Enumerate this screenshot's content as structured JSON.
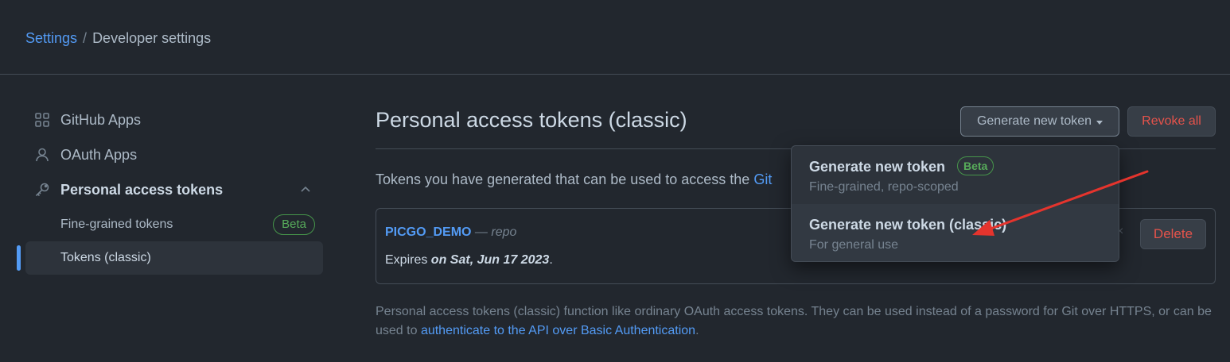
{
  "breadcrumb": {
    "settings_label": "Settings",
    "separator": "/",
    "current_label": "Developer settings"
  },
  "sidebar": {
    "items": [
      {
        "label": "GitHub Apps",
        "icon": "apps-grid-icon"
      },
      {
        "label": "OAuth Apps",
        "icon": "person-icon"
      },
      {
        "label": "Personal access tokens",
        "icon": "key-icon",
        "expanded": true
      }
    ],
    "subitems": [
      {
        "label": "Fine-grained tokens",
        "badge": "Beta"
      },
      {
        "label": "Tokens (classic)",
        "selected": true
      }
    ]
  },
  "main": {
    "title": "Personal access tokens (classic)",
    "generate_button": "Generate new token",
    "revoke_button": "Revoke all",
    "intro_text": "Tokens you have generated that can be used to access the ",
    "intro_link": "Git",
    "token": {
      "name": "PICGO_DEMO",
      "dash": " — ",
      "scope": "repo",
      "expires_prefix": "Expires ",
      "expires_date": "on Sat, Jun 17 2023",
      "expires_suffix": ".",
      "delete_button": "Delete"
    },
    "footnote_text": "Personal access tokens (classic) function like ordinary OAuth access tokens. They can be used instead of a password for Git over HTTPS, or can be used to ",
    "footnote_link": "authenticate to the API over Basic Authentication",
    "footnote_end": "."
  },
  "dropdown": {
    "items": [
      {
        "title": "Generate new token",
        "badge": "Beta",
        "description": "Fine-grained, repo-scoped"
      },
      {
        "title": "Generate new token (classic)",
        "description": "For general use"
      }
    ]
  },
  "colors": {
    "background": "#22272e",
    "link": "#539bf5",
    "danger": "#e5534b",
    "success": "#57ab5a",
    "annotation_arrow": "#e5342d"
  }
}
